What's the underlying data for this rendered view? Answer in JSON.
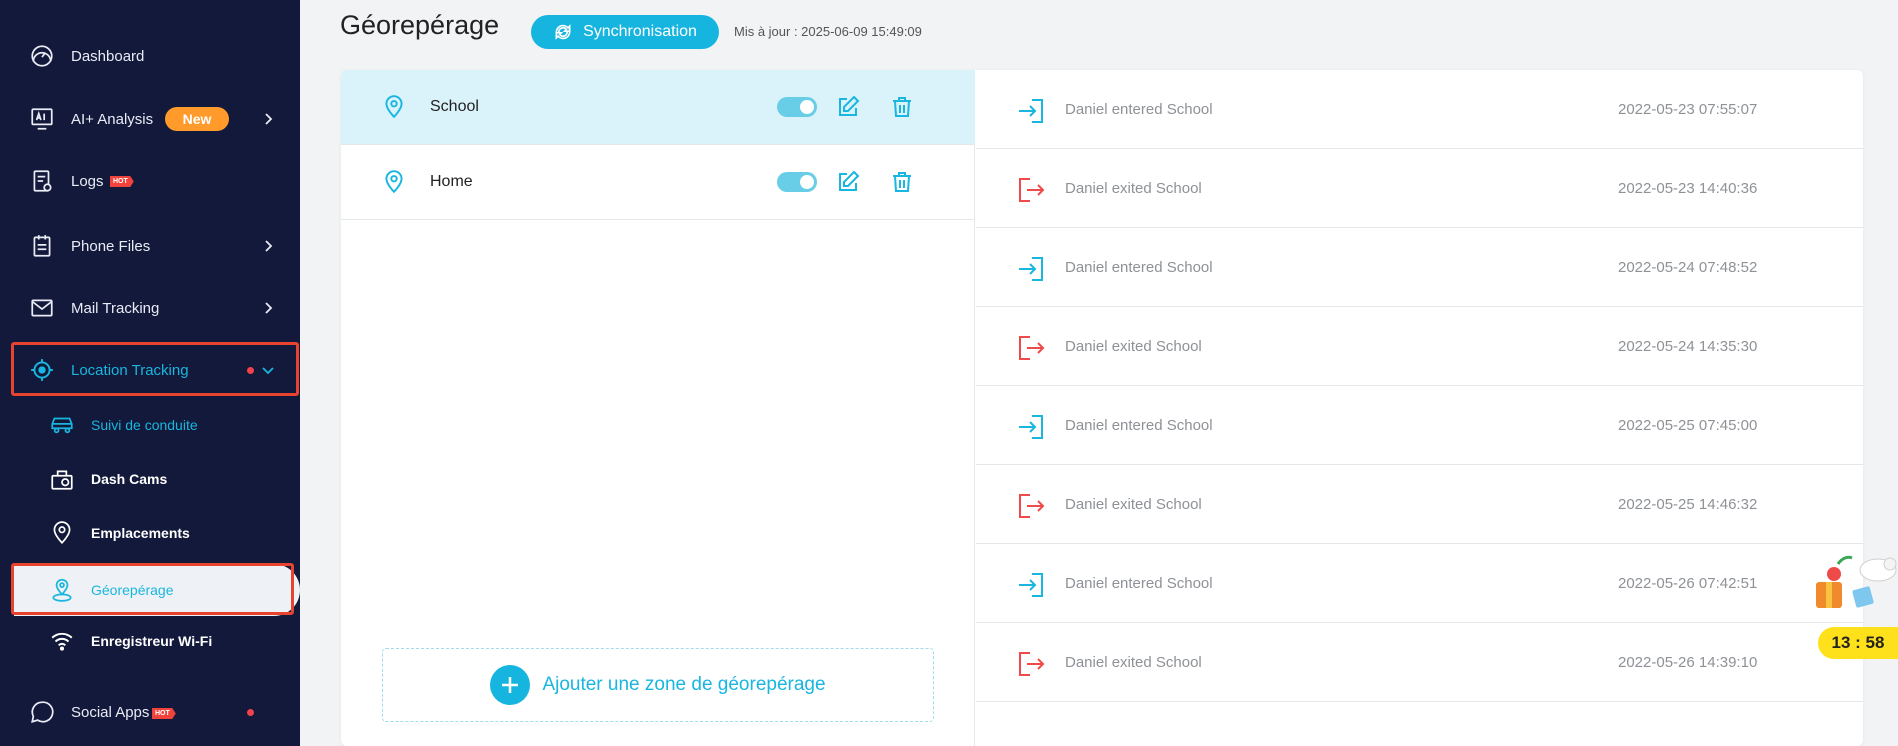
{
  "sidebar": {
    "items": [
      {
        "label": "Dashboard",
        "icon": "dashboard-icon"
      },
      {
        "label": "AI+ Analysis",
        "icon": "ai-icon",
        "badge": "New"
      },
      {
        "label": "Logs",
        "icon": "logs-icon",
        "tag": "HOT"
      },
      {
        "label": "Phone Files",
        "icon": "phone-files-icon"
      },
      {
        "label": "Mail Tracking",
        "icon": "mail-icon"
      },
      {
        "label": "Location Tracking",
        "icon": "crosshair-icon"
      },
      {
        "label": "Social Apps",
        "icon": "chat-icon",
        "tag": "HOT"
      }
    ],
    "subitems": [
      {
        "label": "Suivi de conduite",
        "icon": "car-icon"
      },
      {
        "label": "Dash Cams",
        "icon": "dashcam-icon"
      },
      {
        "label": "Emplacements",
        "icon": "location-pin-icon"
      },
      {
        "label": "Géorepérage",
        "icon": "geofence-icon"
      },
      {
        "label": "Enregistreur Wi-Fi",
        "icon": "wifi-icon"
      }
    ]
  },
  "header": {
    "title": "Géorepérage",
    "sync_label": "Synchronisation",
    "updated": "Mis à jour : 2025-06-09 15:49:09"
  },
  "zones": [
    {
      "name": "School",
      "enabled": true,
      "selected": true
    },
    {
      "name": "Home",
      "enabled": true,
      "selected": false
    }
  ],
  "add_zone_label": "Ajouter une zone de géorepérage",
  "events": [
    {
      "type": "enter",
      "text": "Daniel entered School",
      "time": "2022-05-23 07:55:07"
    },
    {
      "type": "exit",
      "text": "Daniel exited School",
      "time": "2022-05-23 14:40:36"
    },
    {
      "type": "enter",
      "text": "Daniel entered School",
      "time": "2022-05-24 07:48:52"
    },
    {
      "type": "exit",
      "text": "Daniel exited School",
      "time": "2022-05-24 14:35:30"
    },
    {
      "type": "enter",
      "text": "Daniel entered School",
      "time": "2022-05-25 07:45:00"
    },
    {
      "type": "exit",
      "text": "Daniel exited School",
      "time": "2022-05-25 14:46:32"
    },
    {
      "type": "enter",
      "text": "Daniel entered School",
      "time": "2022-05-26 07:42:51"
    },
    {
      "type": "exit",
      "text": "Daniel exited School",
      "time": "2022-05-26 14:39:10"
    }
  ],
  "timer": "13 : 58",
  "colors": {
    "sidebar_bg": "#12193a",
    "accent": "#16b5df",
    "enter": "#19b6df",
    "exit": "#ef4a4a",
    "badge_new": "#ff9a2b",
    "highlight": "#e8432f"
  }
}
